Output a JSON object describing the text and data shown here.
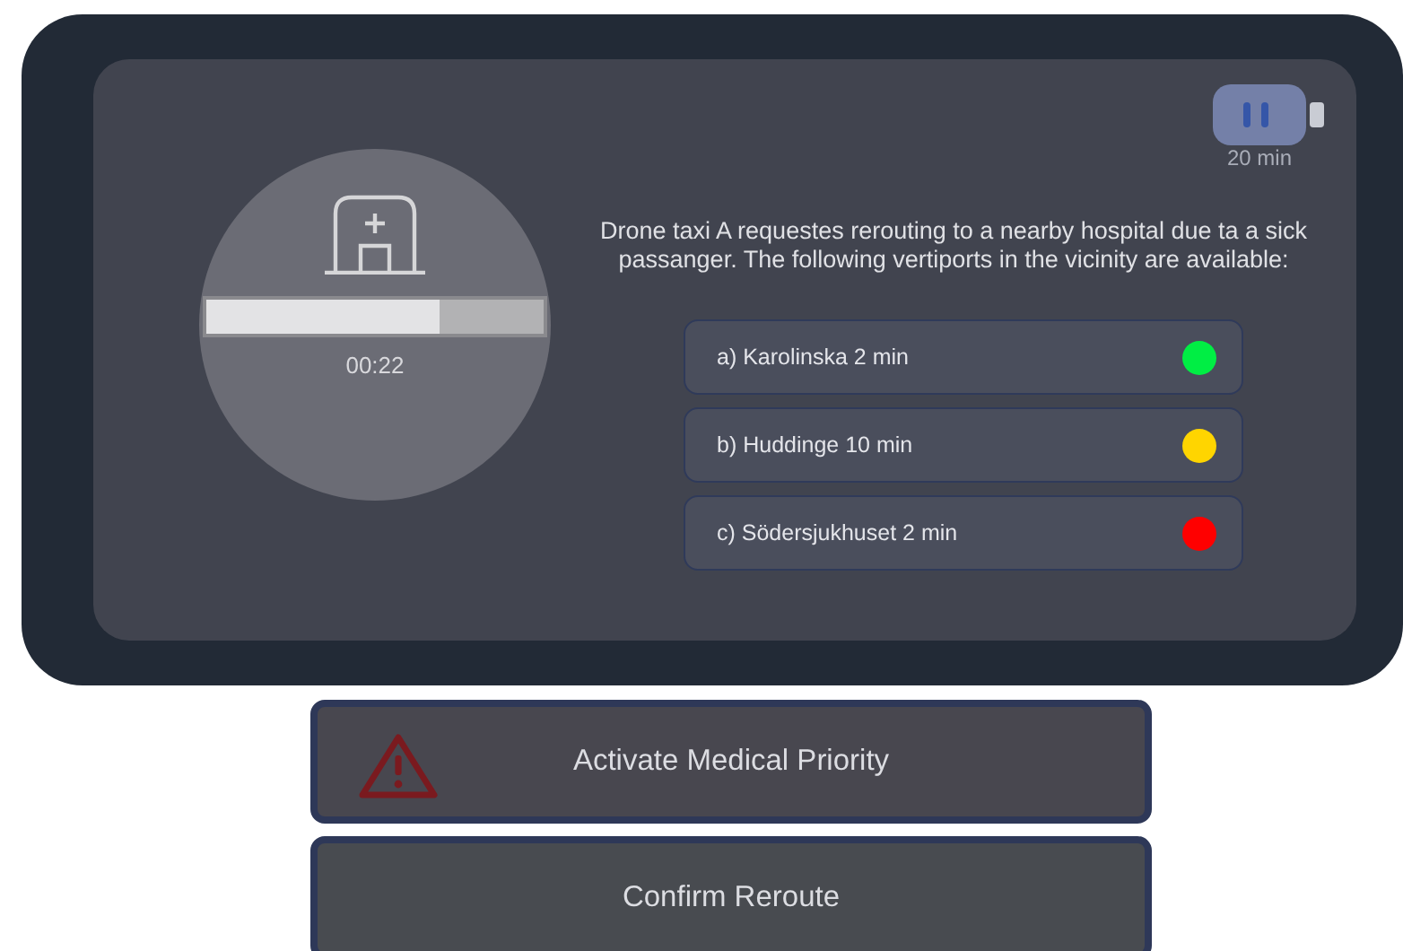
{
  "battery": {
    "label": "20 min"
  },
  "timer": {
    "level": 0.69,
    "time": "00:22"
  },
  "question": "Drone taxi A requestes rerouting to a nearby hospital due ta a sick passanger. The following vertiports in the vicinity are available:",
  "options": [
    {
      "label": "a) Karolinska 2 min",
      "color": "#00ee44"
    },
    {
      "label": "b) Huddinge 10 min",
      "color": "#ffd500"
    },
    {
      "label": "c) Södersjukhuset 2 min",
      "color": "#ff0000"
    }
  ],
  "buttons": [
    {
      "label": "Activate Medical Priority",
      "kind": "warning"
    },
    {
      "label": "Confirm Reroute",
      "kind": "plain"
    }
  ]
}
